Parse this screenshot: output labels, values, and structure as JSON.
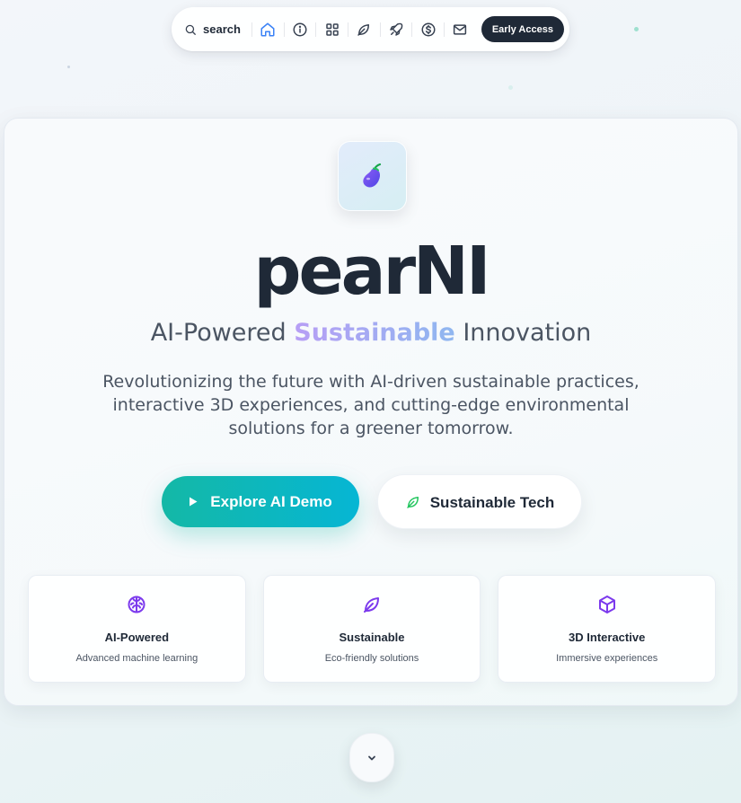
{
  "nav": {
    "search_label": "search",
    "icons": [
      "home-icon",
      "info-icon",
      "grid-icon",
      "leaf-icon",
      "rocket-icon",
      "dollar-icon",
      "mail-icon"
    ],
    "active_icon": "home-icon",
    "cta_label": "Early Access"
  },
  "hero": {
    "logo_icon": "eggplant-icon",
    "title": "pearNI",
    "tagline_before": "AI-Powered",
    "tagline_highlight": "Sustainable",
    "tagline_after": "Innovation",
    "description": "Revolutionizing the future with AI-driven sustainable practices, interactive 3D experiences, and cutting-edge environmental solutions for a greener tomorrow.",
    "primary_button": "Explore AI Demo",
    "secondary_button": "Sustainable Tech"
  },
  "features": [
    {
      "icon": "brain-icon",
      "title": "AI-Powered",
      "subtitle": "Advanced machine learning"
    },
    {
      "icon": "leaf-icon",
      "title": "Sustainable",
      "subtitle": "Eco-friendly solutions"
    },
    {
      "icon": "cube-icon",
      "title": "3D Interactive",
      "subtitle": "Immersive experiences"
    }
  ],
  "scroll_icon": "chevron-down-icon",
  "colors": {
    "accent_teal": "#14b8a6",
    "accent_cyan": "#06b6d4",
    "accent_purple": "#7c3aed",
    "nav_active": "#3b82f6",
    "leaf_green": "#22c55e",
    "dark": "#1f2937"
  }
}
